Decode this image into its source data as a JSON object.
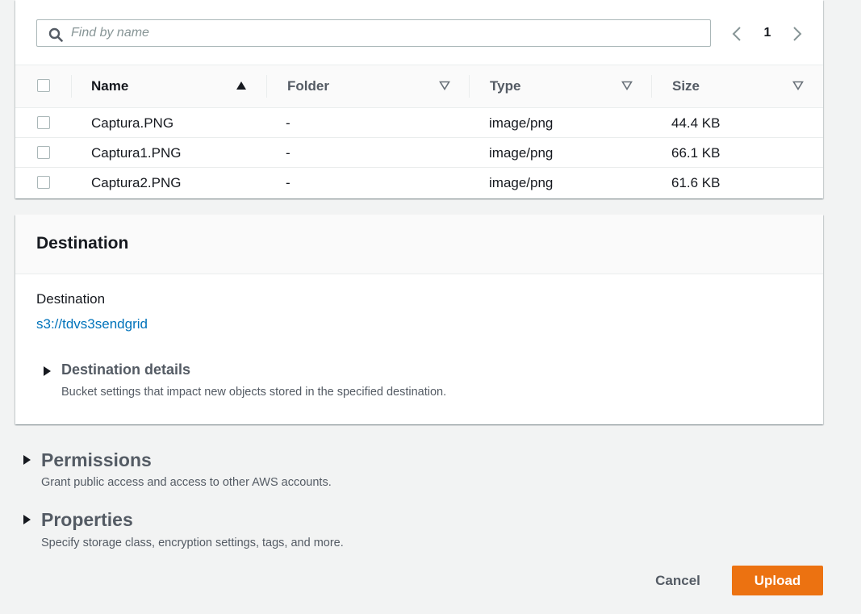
{
  "files_table": {
    "search": {
      "placeholder": "Find by name",
      "value": ""
    },
    "pagination": {
      "current_page": "1"
    },
    "columns": [
      {
        "label": "Name",
        "sort": "ascending"
      },
      {
        "label": "Folder",
        "sort": "none"
      },
      {
        "label": "Type",
        "sort": "none"
      },
      {
        "label": "Size",
        "sort": "none"
      }
    ],
    "rows": [
      {
        "name": "Captura.PNG",
        "folder": "-",
        "type": "image/png",
        "size": "44.4 KB"
      },
      {
        "name": "Captura1.PNG",
        "folder": "-",
        "type": "image/png",
        "size": "66.1 KB"
      },
      {
        "name": "Captura2.PNG",
        "folder": "-",
        "type": "image/png",
        "size": "61.6 KB"
      }
    ]
  },
  "destination": {
    "title": "Destination",
    "label": "Destination",
    "link": "s3://tdvs3sendgrid",
    "details": {
      "title": "Destination details",
      "description": "Bucket settings that impact new objects stored in the specified destination."
    }
  },
  "permissions": {
    "title": "Permissions",
    "description": "Grant public access and access to other AWS accounts."
  },
  "properties": {
    "title": "Properties",
    "description": "Specify storage class, encryption settings, tags, and more."
  },
  "actions": {
    "cancel_label": "Cancel",
    "upload_label": "Upload"
  },
  "colors": {
    "primary_button": "#ec7211",
    "link": "#0073bb",
    "background": "#f2f3f3"
  }
}
